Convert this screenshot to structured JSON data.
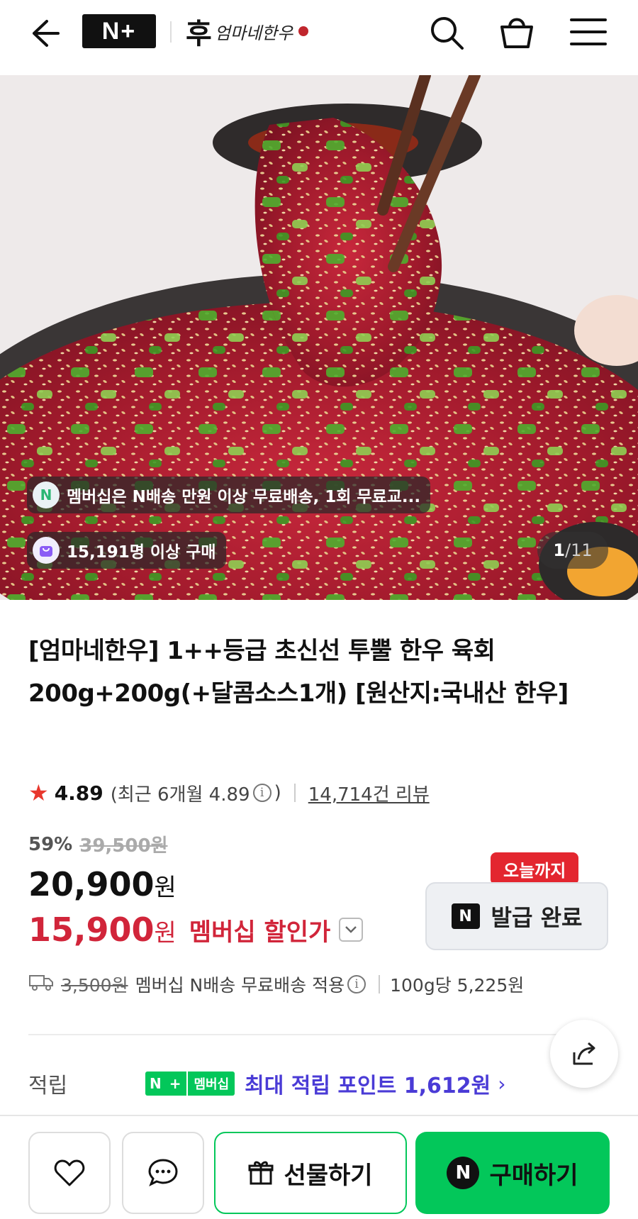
{
  "header": {
    "nplus_logo": "N+",
    "brand_logo_text": "엄마네한우",
    "icons": [
      "back-arrow-icon",
      "search-icon",
      "shopping-bag-icon",
      "menu-icon"
    ]
  },
  "hero": {
    "benefit_text": "멤버십은 N배송 만원 이상 무료배송, 1회 무료교...",
    "buyers_text": "15,191명 이상 구매",
    "image_index": "1",
    "image_total": "/11"
  },
  "product": {
    "title": "[엄마네한우] 1++등급 초신선 투뿔 한우 육회 200g+200g(+달콤소스1개) [원산지:국내산 한우]",
    "rating": "4.89",
    "recent_rating_text": "(최근 6개월 4.89",
    "recent_rating_close": ")",
    "review_count": "14,714건 리뷰",
    "discount_rate": "59%",
    "original_price": "39,500원",
    "sale_price": "20,900",
    "member_price": "15,900",
    "won": "원",
    "member_price_label": "멤버십 할인가",
    "coupon_badge": "오늘까지",
    "coupon_button": "발급 완료",
    "delivery_old_fee": "3,500원",
    "delivery_text": "멤버십 N배송 무료배송 적용",
    "unit_price": "100g당 5,225원",
    "points_label": "적립",
    "points_badge_n": "N +",
    "points_badge_member": "멤버십",
    "points_text": "최대 적립 포인트 1,612원"
  },
  "bottom_bar": {
    "gift_label": "선물하기",
    "buy_label": "구매하기"
  },
  "colors": {
    "naver_green": "#03c75a",
    "member_red": "#d1253a",
    "points_purple": "#4a3bd6"
  }
}
